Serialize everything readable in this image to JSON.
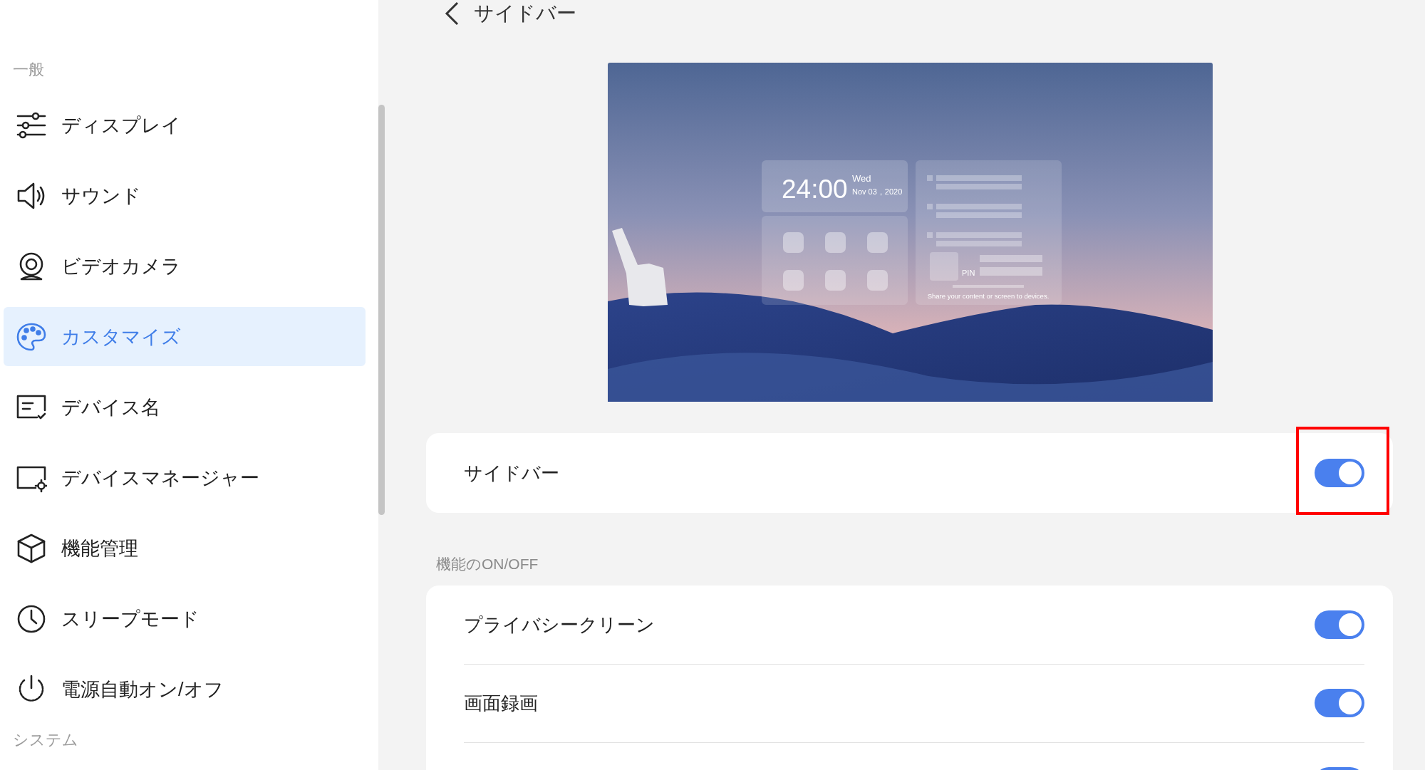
{
  "sidebar": {
    "groups": [
      {
        "title": "一般",
        "items": [
          {
            "label": "ディスプレイ",
            "selected": false
          },
          {
            "label": "サウンド",
            "selected": false
          },
          {
            "label": "ビデオカメラ",
            "selected": false
          },
          {
            "label": "カスタマイズ",
            "selected": true
          },
          {
            "label": "デバイス名",
            "selected": false
          },
          {
            "label": "デバイスマネージャー",
            "selected": false
          },
          {
            "label": "機能管理",
            "selected": false
          },
          {
            "label": "スリープモード",
            "selected": false
          },
          {
            "label": "電源自動オン/オフ",
            "selected": false
          }
        ]
      },
      {
        "title": "システム"
      }
    ]
  },
  "header": {
    "title": "サイドバー"
  },
  "preview": {
    "clock": "24:00",
    "weekday": "Wed",
    "date": "Nov 03，2020",
    "pin_label": "PIN",
    "share_hint": "Share your content or screen to devices."
  },
  "sidebar_setting": {
    "label": "サイドバー",
    "on": true,
    "highlighted": true
  },
  "features": {
    "title": "機能のON/OFF",
    "items": [
      {
        "label": "プライバシークリーン",
        "on": true
      },
      {
        "label": "画面録画",
        "on": true
      },
      {
        "on": true
      }
    ]
  }
}
